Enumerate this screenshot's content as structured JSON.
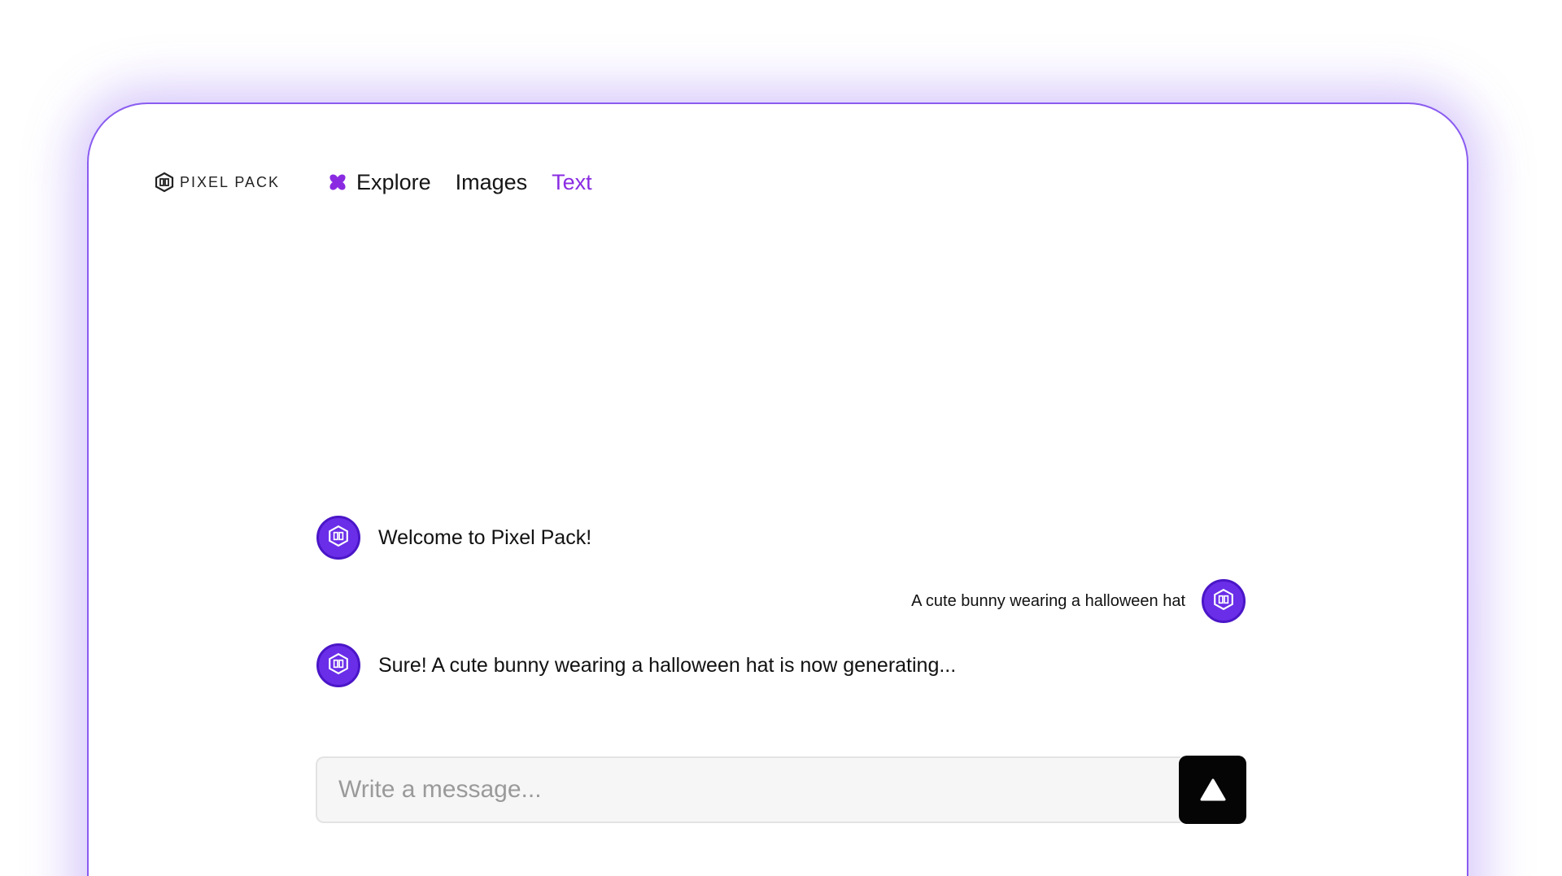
{
  "brand": {
    "name": "PIXEL PACK",
    "accent": "#6a2ee8",
    "active_nav_color": "#8a2be2"
  },
  "nav": {
    "items": [
      {
        "label": "Explore",
        "icon": "sparkle-icon",
        "active": false
      },
      {
        "label": "Images",
        "active": false
      },
      {
        "label": "Text",
        "active": true
      }
    ]
  },
  "chat": {
    "messages": [
      {
        "role": "assistant",
        "text": "Welcome to Pixel Pack!",
        "avatar": "pixel-pack-logo-icon"
      },
      {
        "role": "user",
        "text": "A cute bunny wearing a halloween hat",
        "avatar": "pixel-pack-logo-icon"
      },
      {
        "role": "assistant",
        "text": "Sure! A cute bunny wearing a halloween hat is now generating...",
        "avatar": "pixel-pack-logo-icon"
      }
    ]
  },
  "composer": {
    "placeholder": "Write a message...",
    "value": "",
    "send_icon": "send-arrow-up-icon"
  }
}
